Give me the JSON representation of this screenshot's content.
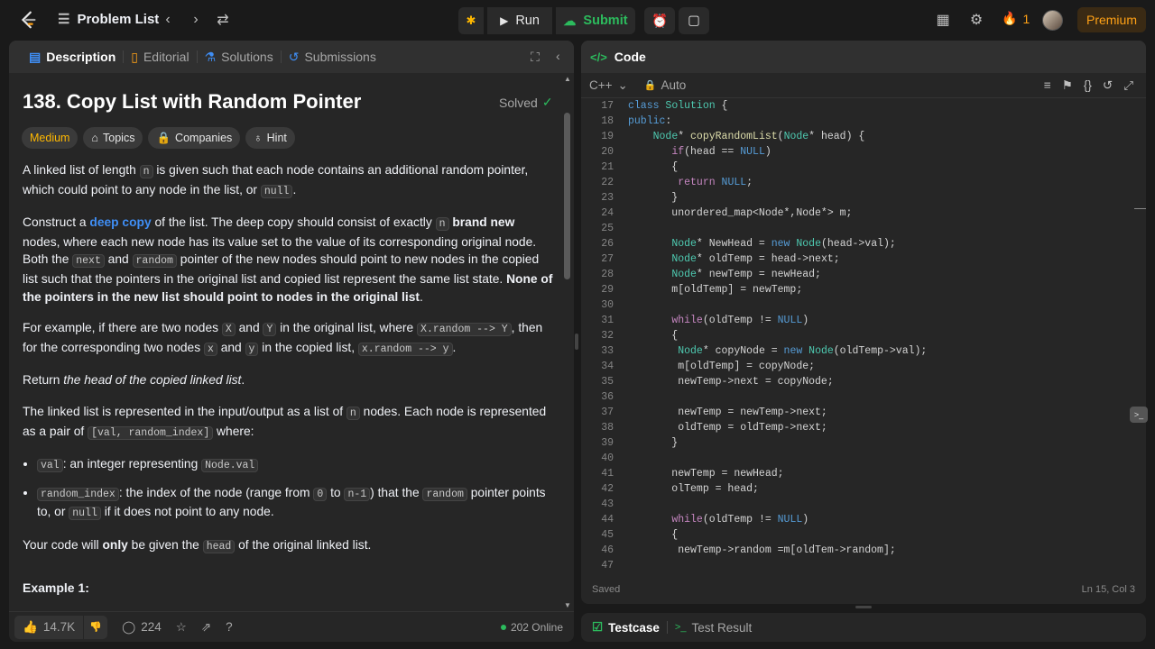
{
  "topbar": {
    "problem_list_label": "Problem List",
    "run_label": "Run",
    "submit_label": "Submit",
    "streak_count": "1",
    "premium_label": "Premium"
  },
  "left_tabs": {
    "description": "Description",
    "editorial": "Editorial",
    "solutions": "Solutions",
    "submissions": "Submissions"
  },
  "problem": {
    "title": "138. Copy List with Random Pointer",
    "status": "Solved",
    "tags": [
      "Medium",
      "Topics",
      "Companies",
      "Hint"
    ],
    "example_title": "Example 1:"
  },
  "footer": {
    "likes": "14.7K",
    "comments": "224",
    "online": "202 Online"
  },
  "code_panel": {
    "title": "Code",
    "language": "C++",
    "auto_label": "Auto",
    "status_saved": "Saved",
    "cursor": "Ln 15, Col 3"
  },
  "bottom_tabs": {
    "testcase": "Testcase",
    "result": "Test Result"
  }
}
